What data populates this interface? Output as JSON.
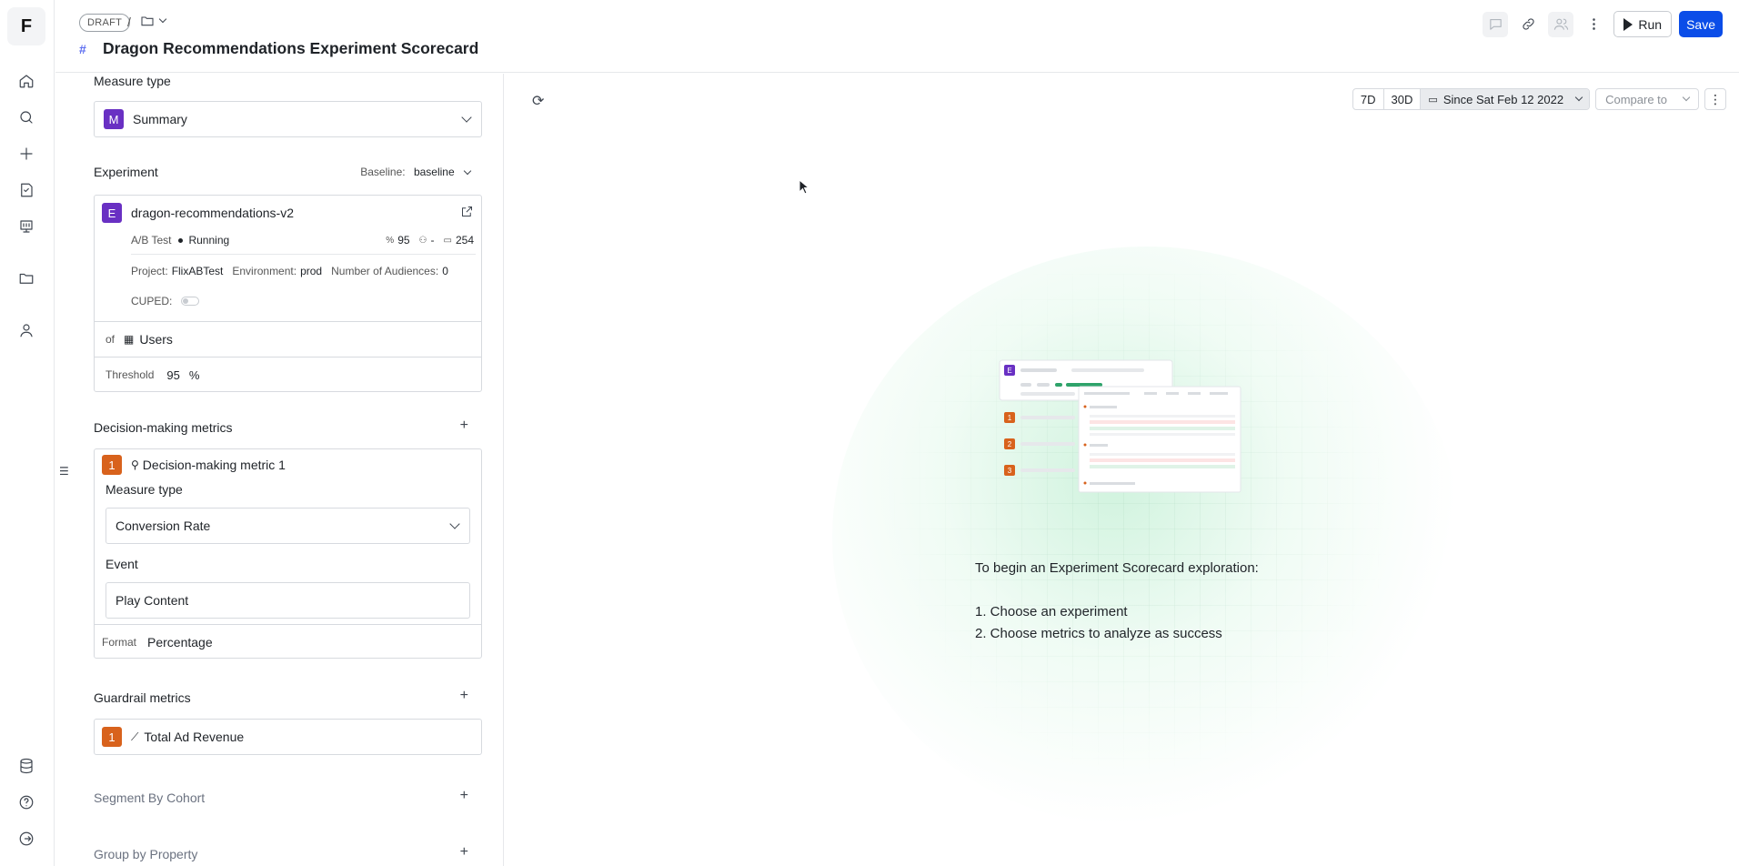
{
  "rail": {
    "logo": "F"
  },
  "header": {
    "draft_label": "DRAFT",
    "breadcrumb_separator": "/",
    "title": "Dragon Recommendations Experiment Scorecard",
    "run_label": "Run",
    "save_label": "Save"
  },
  "panel": {
    "measure_type": {
      "label": "Measure type",
      "badge": "M",
      "value": "Summary"
    },
    "experiment": {
      "label": "Experiment",
      "baseline_label": "Baseline:",
      "baseline_value": "baseline",
      "badge": "E",
      "name": "dragon-recommendations-v2",
      "type": "A/B Test",
      "status": "Running",
      "confidence": "95",
      "audience": "-",
      "days": "254",
      "project_label": "Project:",
      "project_value": "FlixABTest",
      "environment_label": "Environment:",
      "environment_value": "prod",
      "audiences_label": "Number of Audiences:",
      "audiences_value": "0",
      "cuped_label": "CUPED:",
      "of_label": "of",
      "of_value": "Users",
      "threshold_label": "Threshold",
      "threshold_value": "95",
      "threshold_unit": "%"
    },
    "decision_metrics": {
      "label": "Decision-making metrics",
      "items": [
        {
          "badge": "1",
          "name": "Decision-making metric 1",
          "measure_label": "Measure type",
          "measure_value": "Conversion Rate",
          "event_label": "Event",
          "event_value": "Play Content",
          "format_label": "Format",
          "format_value": "Percentage"
        }
      ]
    },
    "guardrail_metrics": {
      "label": "Guardrail metrics",
      "items": [
        {
          "badge": "1",
          "name": "Total Ad Revenue"
        }
      ]
    },
    "segment_by_cohort": {
      "label": "Segment By Cohort"
    },
    "group_by_property": {
      "label": "Group by Property"
    }
  },
  "main": {
    "range_7d": "7D",
    "range_30d": "30D",
    "since": "Since Sat Feb 12 2022",
    "compare": "Compare to",
    "illustration": {
      "badges": [
        "E",
        "1",
        "2",
        "3"
      ]
    },
    "intro": "To begin an Experiment Scorecard exploration:",
    "steps": [
      "1. Choose an experiment",
      "2. Choose metrics to analyze as success"
    ]
  },
  "colors": {
    "primary": "#0b4de8",
    "purple_badge": "#6930c3",
    "orange_badge": "#d8621c"
  }
}
